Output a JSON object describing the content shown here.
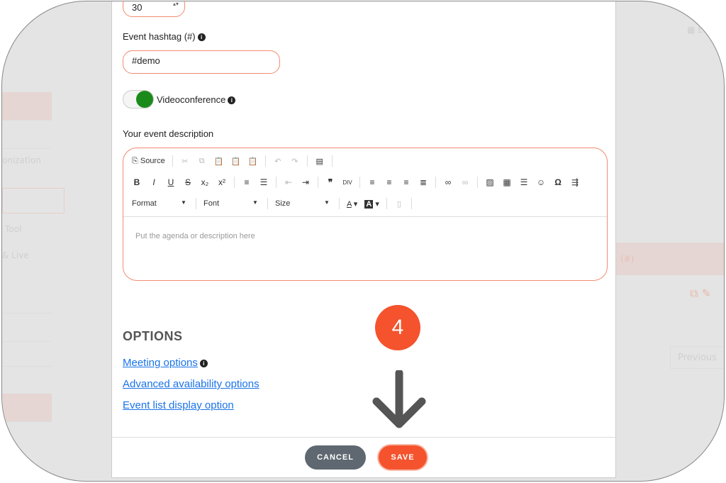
{
  "background": {
    "sidebar_items": [
      "onization",
      "Tool",
      "& Live"
    ],
    "table_header": "(#)",
    "pagination_previous": "Previous",
    "lang": "E"
  },
  "form": {
    "duration_value": "30",
    "hashtag_label": "Event hashtag (#)",
    "hashtag_value": "#demo",
    "videoconference_label": "Videoconference",
    "videoconference_on": true,
    "description_label": "Your event description",
    "description_placeholder": "Put the agenda or description here"
  },
  "editor": {
    "source_label": "Source",
    "format_label": "Format",
    "font_label": "Font",
    "size_label": "Size"
  },
  "options": {
    "title": "OPTIONS",
    "links": [
      "Meeting options",
      "Advanced availability options",
      "Event list display option"
    ]
  },
  "footer": {
    "cancel_label": "CANCEL",
    "save_label": "SAVE"
  },
  "annotation": {
    "step": "4"
  },
  "colors": {
    "accent": "#f4532e",
    "toggle_on": "#1a8a1a",
    "cancel": "#5f6870",
    "link": "#1a73e8"
  }
}
